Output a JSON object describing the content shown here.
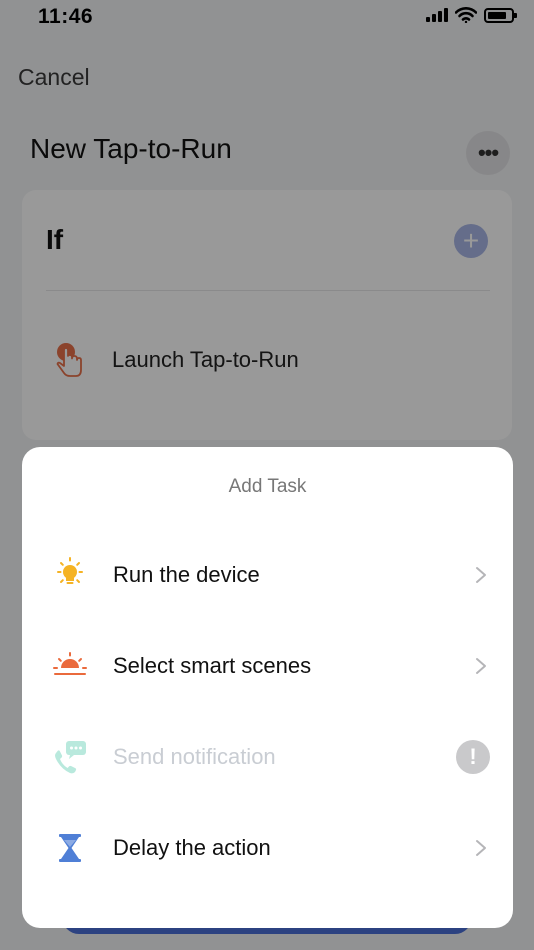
{
  "status_bar": {
    "time": "11:46"
  },
  "nav": {
    "cancel_label": "Cancel"
  },
  "page": {
    "title": "New Tap-to-Run",
    "more_label": "•••"
  },
  "if_section": {
    "label": "If",
    "add_label": "+",
    "condition_label": "Launch Tap-to-Run"
  },
  "sheet": {
    "title": "Add Task",
    "items": [
      {
        "label": "Run the device",
        "icon": "bulb-icon",
        "enabled": true
      },
      {
        "label": "Select smart scenes",
        "icon": "sunrise-icon",
        "enabled": true
      },
      {
        "label": "Send notification",
        "icon": "phone-message-icon",
        "enabled": false,
        "badge": "!"
      },
      {
        "label": "Delay the action",
        "icon": "hourglass-icon",
        "enabled": true
      }
    ]
  },
  "colors": {
    "accent_blue": "#4a6fd8",
    "bulb_yellow": "#f5b324",
    "scene_orange": "#ea6a3c",
    "hourglass_blue": "#4f7fd6",
    "disabled_teal": "#b9e9dd"
  }
}
